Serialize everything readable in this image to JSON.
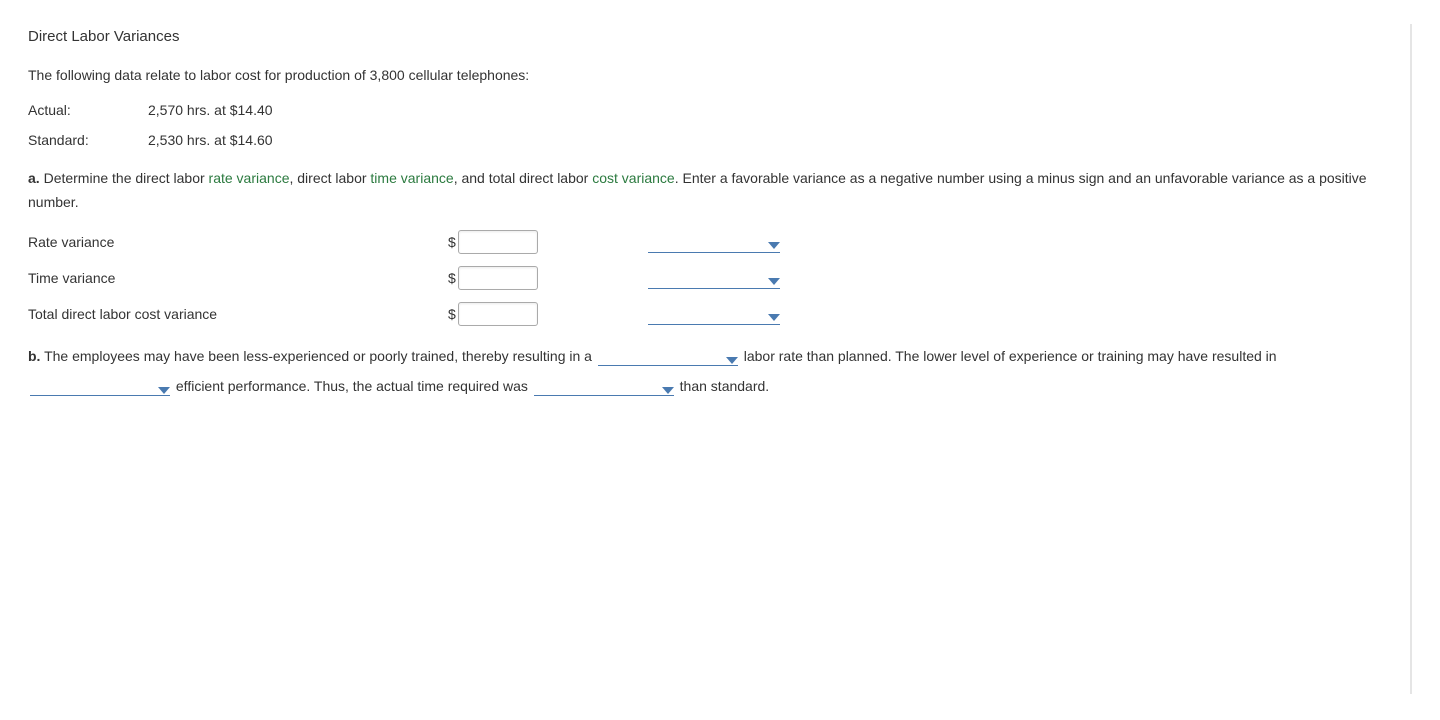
{
  "title": "Direct Labor Variances",
  "intro": "The following data relate to labor cost for production of 3,800 cellular telephones:",
  "data": {
    "actual_label": "Actual:",
    "actual_value": "2,570 hrs. at $14.40",
    "standard_label": "Standard:",
    "standard_value": "2,530 hrs. at $14.60"
  },
  "partA": {
    "prefix": "a.",
    "seg1": " Determine the direct labor ",
    "link1": "rate variance",
    "seg2": ", direct labor ",
    "link2": "time variance",
    "seg3": ", and total direct labor ",
    "link3": "cost variance",
    "seg4": ". Enter a favorable variance as a negative number using a minus sign and an unfavorable variance as a positive number."
  },
  "rows": {
    "rate": "Rate variance",
    "time": "Time variance",
    "total": "Total direct labor cost variance",
    "currency": "$"
  },
  "partB": {
    "prefix": "b.",
    "seg1": " The employees may have been less-experienced or poorly trained, thereby resulting in a ",
    "seg2": " labor rate than planned. The lower level of experience or training may have resulted in ",
    "seg3": " efficient performance. Thus, the actual time required was ",
    "seg4": " than standard."
  }
}
